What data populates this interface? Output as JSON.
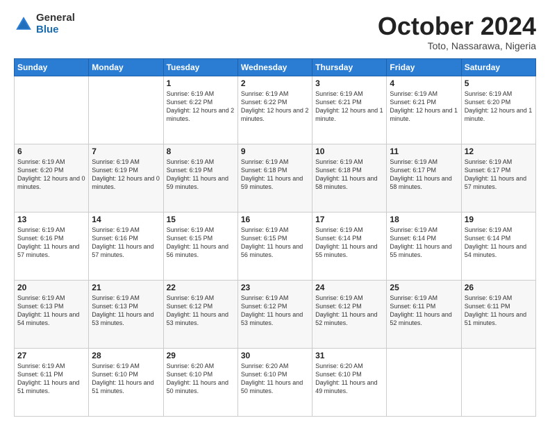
{
  "logo": {
    "general": "General",
    "blue": "Blue"
  },
  "header": {
    "month": "October 2024",
    "location": "Toto, Nassarawa, Nigeria"
  },
  "days_of_week": [
    "Sunday",
    "Monday",
    "Tuesday",
    "Wednesday",
    "Thursday",
    "Friday",
    "Saturday"
  ],
  "weeks": [
    [
      {
        "day": "",
        "info": ""
      },
      {
        "day": "",
        "info": ""
      },
      {
        "day": "1",
        "info": "Sunrise: 6:19 AM\nSunset: 6:22 PM\nDaylight: 12 hours and 2 minutes."
      },
      {
        "day": "2",
        "info": "Sunrise: 6:19 AM\nSunset: 6:22 PM\nDaylight: 12 hours and 2 minutes."
      },
      {
        "day": "3",
        "info": "Sunrise: 6:19 AM\nSunset: 6:21 PM\nDaylight: 12 hours and 1 minute."
      },
      {
        "day": "4",
        "info": "Sunrise: 6:19 AM\nSunset: 6:21 PM\nDaylight: 12 hours and 1 minute."
      },
      {
        "day": "5",
        "info": "Sunrise: 6:19 AM\nSunset: 6:20 PM\nDaylight: 12 hours and 1 minute."
      }
    ],
    [
      {
        "day": "6",
        "info": "Sunrise: 6:19 AM\nSunset: 6:20 PM\nDaylight: 12 hours and 0 minutes."
      },
      {
        "day": "7",
        "info": "Sunrise: 6:19 AM\nSunset: 6:19 PM\nDaylight: 12 hours and 0 minutes."
      },
      {
        "day": "8",
        "info": "Sunrise: 6:19 AM\nSunset: 6:19 PM\nDaylight: 11 hours and 59 minutes."
      },
      {
        "day": "9",
        "info": "Sunrise: 6:19 AM\nSunset: 6:18 PM\nDaylight: 11 hours and 59 minutes."
      },
      {
        "day": "10",
        "info": "Sunrise: 6:19 AM\nSunset: 6:18 PM\nDaylight: 11 hours and 58 minutes."
      },
      {
        "day": "11",
        "info": "Sunrise: 6:19 AM\nSunset: 6:17 PM\nDaylight: 11 hours and 58 minutes."
      },
      {
        "day": "12",
        "info": "Sunrise: 6:19 AM\nSunset: 6:17 PM\nDaylight: 11 hours and 57 minutes."
      }
    ],
    [
      {
        "day": "13",
        "info": "Sunrise: 6:19 AM\nSunset: 6:16 PM\nDaylight: 11 hours and 57 minutes."
      },
      {
        "day": "14",
        "info": "Sunrise: 6:19 AM\nSunset: 6:16 PM\nDaylight: 11 hours and 57 minutes."
      },
      {
        "day": "15",
        "info": "Sunrise: 6:19 AM\nSunset: 6:15 PM\nDaylight: 11 hours and 56 minutes."
      },
      {
        "day": "16",
        "info": "Sunrise: 6:19 AM\nSunset: 6:15 PM\nDaylight: 11 hours and 56 minutes."
      },
      {
        "day": "17",
        "info": "Sunrise: 6:19 AM\nSunset: 6:14 PM\nDaylight: 11 hours and 55 minutes."
      },
      {
        "day": "18",
        "info": "Sunrise: 6:19 AM\nSunset: 6:14 PM\nDaylight: 11 hours and 55 minutes."
      },
      {
        "day": "19",
        "info": "Sunrise: 6:19 AM\nSunset: 6:14 PM\nDaylight: 11 hours and 54 minutes."
      }
    ],
    [
      {
        "day": "20",
        "info": "Sunrise: 6:19 AM\nSunset: 6:13 PM\nDaylight: 11 hours and 54 minutes."
      },
      {
        "day": "21",
        "info": "Sunrise: 6:19 AM\nSunset: 6:13 PM\nDaylight: 11 hours and 53 minutes."
      },
      {
        "day": "22",
        "info": "Sunrise: 6:19 AM\nSunset: 6:12 PM\nDaylight: 11 hours and 53 minutes."
      },
      {
        "day": "23",
        "info": "Sunrise: 6:19 AM\nSunset: 6:12 PM\nDaylight: 11 hours and 53 minutes."
      },
      {
        "day": "24",
        "info": "Sunrise: 6:19 AM\nSunset: 6:12 PM\nDaylight: 11 hours and 52 minutes."
      },
      {
        "day": "25",
        "info": "Sunrise: 6:19 AM\nSunset: 6:11 PM\nDaylight: 11 hours and 52 minutes."
      },
      {
        "day": "26",
        "info": "Sunrise: 6:19 AM\nSunset: 6:11 PM\nDaylight: 11 hours and 51 minutes."
      }
    ],
    [
      {
        "day": "27",
        "info": "Sunrise: 6:19 AM\nSunset: 6:11 PM\nDaylight: 11 hours and 51 minutes."
      },
      {
        "day": "28",
        "info": "Sunrise: 6:19 AM\nSunset: 6:10 PM\nDaylight: 11 hours and 51 minutes."
      },
      {
        "day": "29",
        "info": "Sunrise: 6:20 AM\nSunset: 6:10 PM\nDaylight: 11 hours and 50 minutes."
      },
      {
        "day": "30",
        "info": "Sunrise: 6:20 AM\nSunset: 6:10 PM\nDaylight: 11 hours and 50 minutes."
      },
      {
        "day": "31",
        "info": "Sunrise: 6:20 AM\nSunset: 6:10 PM\nDaylight: 11 hours and 49 minutes."
      },
      {
        "day": "",
        "info": ""
      },
      {
        "day": "",
        "info": ""
      }
    ]
  ]
}
